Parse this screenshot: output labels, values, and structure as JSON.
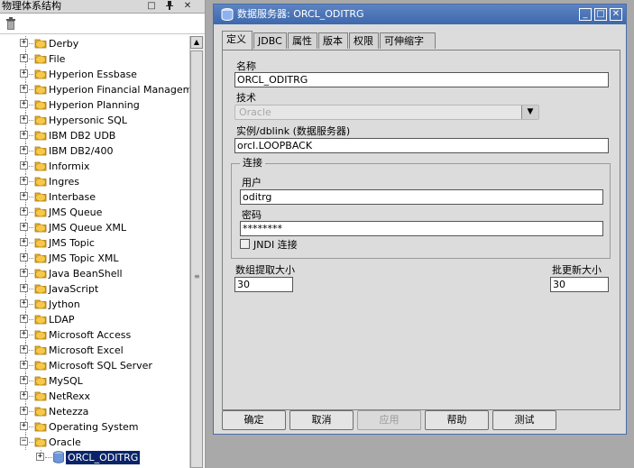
{
  "left_panel": {
    "title": "物理体系结构",
    "tools": {
      "restore": "□",
      "pin": "ᵃ",
      "close": "✕"
    }
  },
  "tree": {
    "items": [
      {
        "label": "Derby"
      },
      {
        "label": "File"
      },
      {
        "label": "Hyperion Essbase"
      },
      {
        "label": "Hyperion Financial Management"
      },
      {
        "label": "Hyperion Planning"
      },
      {
        "label": "Hypersonic SQL"
      },
      {
        "label": "IBM DB2 UDB"
      },
      {
        "label": "IBM DB2/400"
      },
      {
        "label": "Informix"
      },
      {
        "label": "Ingres"
      },
      {
        "label": "Interbase"
      },
      {
        "label": "JMS Queue"
      },
      {
        "label": "JMS Queue XML"
      },
      {
        "label": "JMS Topic"
      },
      {
        "label": "JMS Topic XML"
      },
      {
        "label": "Java BeanShell"
      },
      {
        "label": "JavaScript"
      },
      {
        "label": "Jython"
      },
      {
        "label": "LDAP"
      },
      {
        "label": "Microsoft Access"
      },
      {
        "label": "Microsoft Excel"
      },
      {
        "label": "Microsoft SQL Server"
      },
      {
        "label": "MySQL"
      },
      {
        "label": "NetRexx"
      },
      {
        "label": "Netezza"
      },
      {
        "label": "Operating System"
      },
      {
        "label": "Oracle"
      }
    ],
    "child": {
      "label": "ORCL_ODITRG"
    },
    "expand_symbol": "+",
    "collapse_symbol": "−"
  },
  "dialog": {
    "title": "数据服务器: ORCL_ODITRG",
    "window_buttons": {
      "minimize": "_",
      "maximize": "□",
      "close": "✕"
    },
    "tabs": [
      "定义",
      "JDBC",
      "属性",
      "版本",
      "权限",
      "可伸缩字段"
    ],
    "active_tab": "定义",
    "fields": {
      "name_label": "名称",
      "name_value": "ORCL_ODITRG",
      "technology_label": "技术",
      "technology_value": "Oracle",
      "instance_label": "实例/dblink (数据服务器)",
      "instance_value": "orcl.LOOPBACK"
    },
    "connection": {
      "legend": "连接",
      "user_label": "用户",
      "user_value": "oditrg",
      "password_label": "密码",
      "password_value": "********",
      "jndi_label": "JNDI 连接"
    },
    "array_fetch_label": "数组提取大小",
    "array_fetch_value": "30",
    "batch_update_label": "批更新大小",
    "batch_update_value": "30",
    "buttons": {
      "ok": "确定",
      "cancel": "取消",
      "apply": "应用",
      "help": "帮助",
      "test": "测试"
    }
  },
  "colors": {
    "titlebar": "#4a72b6",
    "folder": "#f0b830",
    "selection": "#0a246a"
  }
}
